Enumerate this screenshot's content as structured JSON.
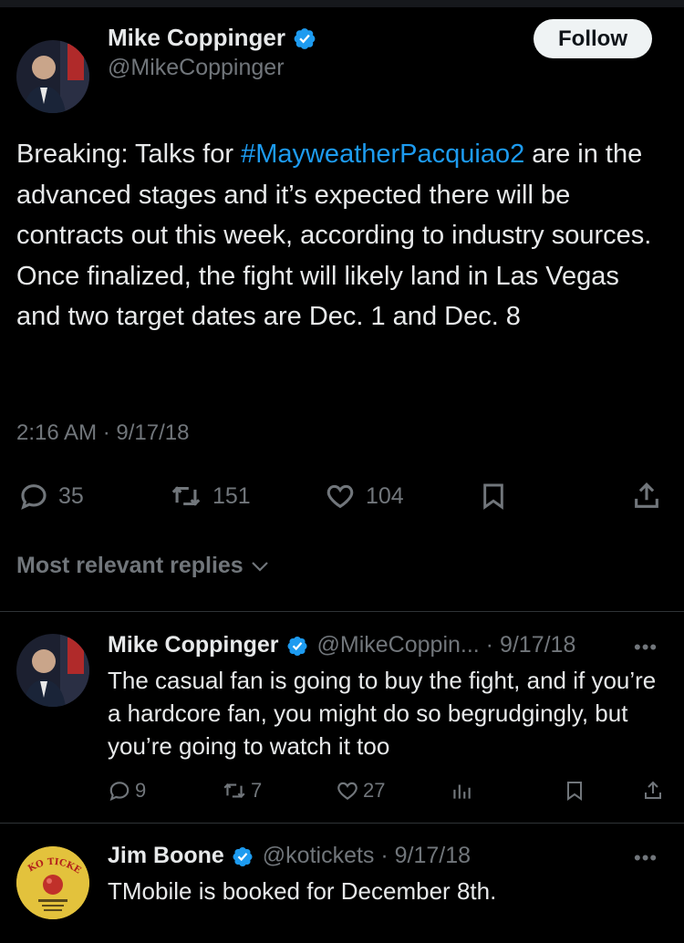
{
  "main_tweet": {
    "author_name": "Mike Coppinger",
    "author_handle": "@MikeCoppinger",
    "follow_label": "Follow",
    "text_before": "Breaking: Talks for ",
    "hashtag": "#MayweatherPacquiao2",
    "text_after": " are in the advanced stages and it’s expected there will be contracts out this week, according to industry sources. Once finalized, the fight will likely land in Las Vegas and two target dates are Dec. 1 and Dec. 8",
    "timestamp": "2:16 AM · 9/17/18",
    "replies": "35",
    "retweets": "151",
    "likes": "104"
  },
  "replies_header": "Most relevant replies",
  "replies": [
    {
      "author_name": "Mike Coppinger",
      "meta": "@MikeCoppin... · 9/17/18",
      "more": "•••",
      "text": "The casual fan is going to buy the fight, and if you’re a hardcore fan, you might do so begrudgingly, but you’re going to watch it too",
      "replies": "9",
      "retweets": "7",
      "likes": "27"
    },
    {
      "author_name": "Jim Boone",
      "meta": "@kotickets · 9/17/18",
      "more": "•••",
      "text": "TMobile is booked for December 8th.",
      "avatar_text": "KO TICKETS"
    }
  ],
  "colors": {
    "background": "#000000",
    "text": "#e7e9ea",
    "muted": "#71767b",
    "accent": "#1d9bf0",
    "divider": "#2f3336"
  }
}
